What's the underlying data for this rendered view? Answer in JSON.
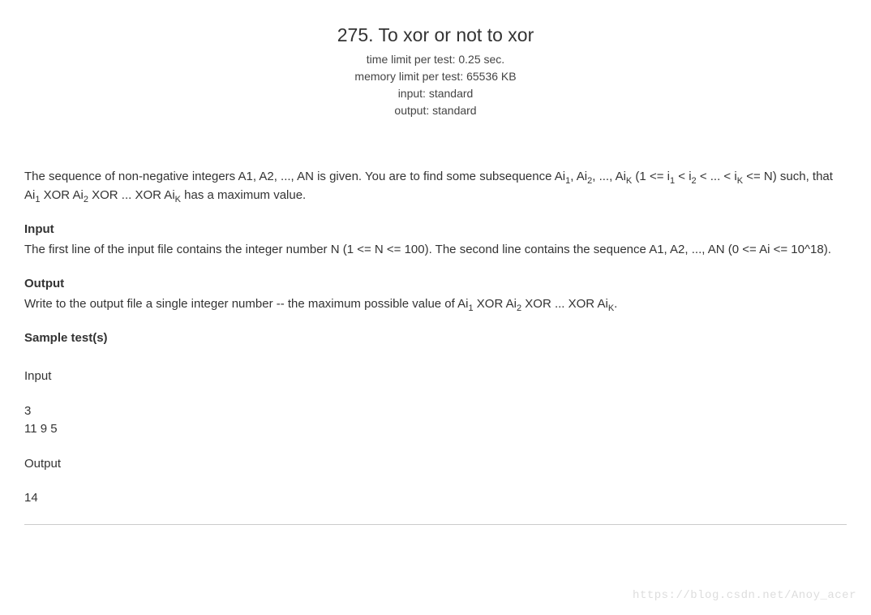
{
  "header": {
    "title": "275. To xor or not to xor",
    "time_limit": "time limit per test: 0.25 sec.",
    "memory_limit": "memory limit per test: 65536 KB",
    "input_std": "input: standard",
    "output_std": "output: standard"
  },
  "problem": {
    "desc_p1a": "The sequence of non-negative integers A1, A2, ..., AN is given. You are to find some subsequence Ai",
    "desc_p1b": ", Ai",
    "desc_p1c": ", ..., Ai",
    "desc_p1d": " (1 <= i",
    "desc_p1e": " < i",
    "desc_p1f": " < ... < i",
    "desc_p1g": " <= N) such, that Ai",
    "desc_p1h": " XOR Ai",
    "desc_p1i": " XOR ... XOR Ai",
    "desc_p1j": " has a maximum value.",
    "sub1": "1",
    "sub2": "2",
    "subK": "K"
  },
  "input": {
    "title": "Input",
    "text": "The first line of the input file contains the integer number N (1 <= N <= 100). The second line contains the sequence A1, A2, ..., AN (0 <= Ai <= 10^18)."
  },
  "output": {
    "title": "Output",
    "text_a": "Write to the output file a single integer number -- the maximum possible value of Ai",
    "text_b": " XOR Ai",
    "text_c": " XOR ... XOR Ai",
    "text_d": "."
  },
  "sample": {
    "title": "Sample test(s)",
    "input_label": "Input",
    "input_line1": "3",
    "input_line2": "11 9 5",
    "output_label": "Output",
    "output_line1": "14"
  },
  "watermark": "https://blog.csdn.net/Anoy_acer"
}
